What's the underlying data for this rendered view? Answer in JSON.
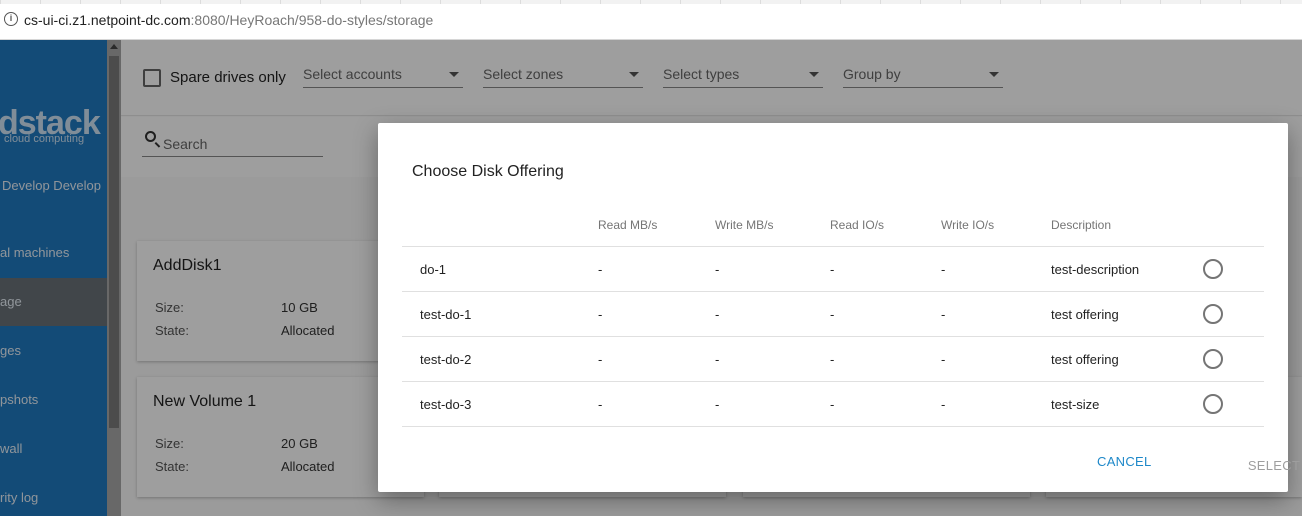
{
  "browser": {
    "url_host": "cs-ui-ci.z1.netpoint-dc.com",
    "url_rest": ":8080/HeyRoach/958-do-styles/storage"
  },
  "sidebar": {
    "logo": "dstack",
    "logo_sub": "cloud computing",
    "user": "Develop Develop",
    "items": [
      {
        "label": "al machines",
        "active": false
      },
      {
        "label": "age",
        "active": true
      },
      {
        "label": "ges",
        "active": false
      },
      {
        "label": "pshots",
        "active": false
      },
      {
        "label": "wall",
        "active": false
      },
      {
        "label": "rity log",
        "active": false
      }
    ]
  },
  "filters": {
    "spare_label": "Spare drives only",
    "accounts": "Select accounts",
    "zones": "Select zones",
    "types": "Select types",
    "group_by": "Group by",
    "search_placeholder": "Search"
  },
  "cards": [
    {
      "title": "AddDisk1",
      "size_label": "Size:",
      "size": "10 GB",
      "state_label": "State:",
      "state": "Allocated"
    },
    {
      "title": "New Volume 1",
      "size_label": "Size:",
      "size": "20 GB",
      "state_label": "State:",
      "state": "Allocated"
    }
  ],
  "dialog": {
    "title": "Choose Disk Offering",
    "columns": [
      "",
      "Read MB/s",
      "Write MB/s",
      "Read IO/s",
      "Write IO/s",
      "Description"
    ],
    "rows": [
      {
        "name": "do-1",
        "read_mbs": "-",
        "write_mbs": "-",
        "read_ios": "-",
        "write_ios": "-",
        "description": "test-description"
      },
      {
        "name": "test-do-1",
        "read_mbs": "-",
        "write_mbs": "-",
        "read_ios": "-",
        "write_ios": "-",
        "description": "test offering"
      },
      {
        "name": "test-do-2",
        "read_mbs": "-",
        "write_mbs": "-",
        "read_ios": "-",
        "write_ios": "-",
        "description": "test offering"
      },
      {
        "name": "test-do-3",
        "read_mbs": "-",
        "write_mbs": "-",
        "read_ios": "-",
        "write_ios": "-",
        "description": "test-size"
      }
    ],
    "cancel_label": "CANCEL",
    "select_label": "SELECT"
  },
  "colors": {
    "primary": "#1f79c1",
    "accent": "#1e88c9"
  }
}
